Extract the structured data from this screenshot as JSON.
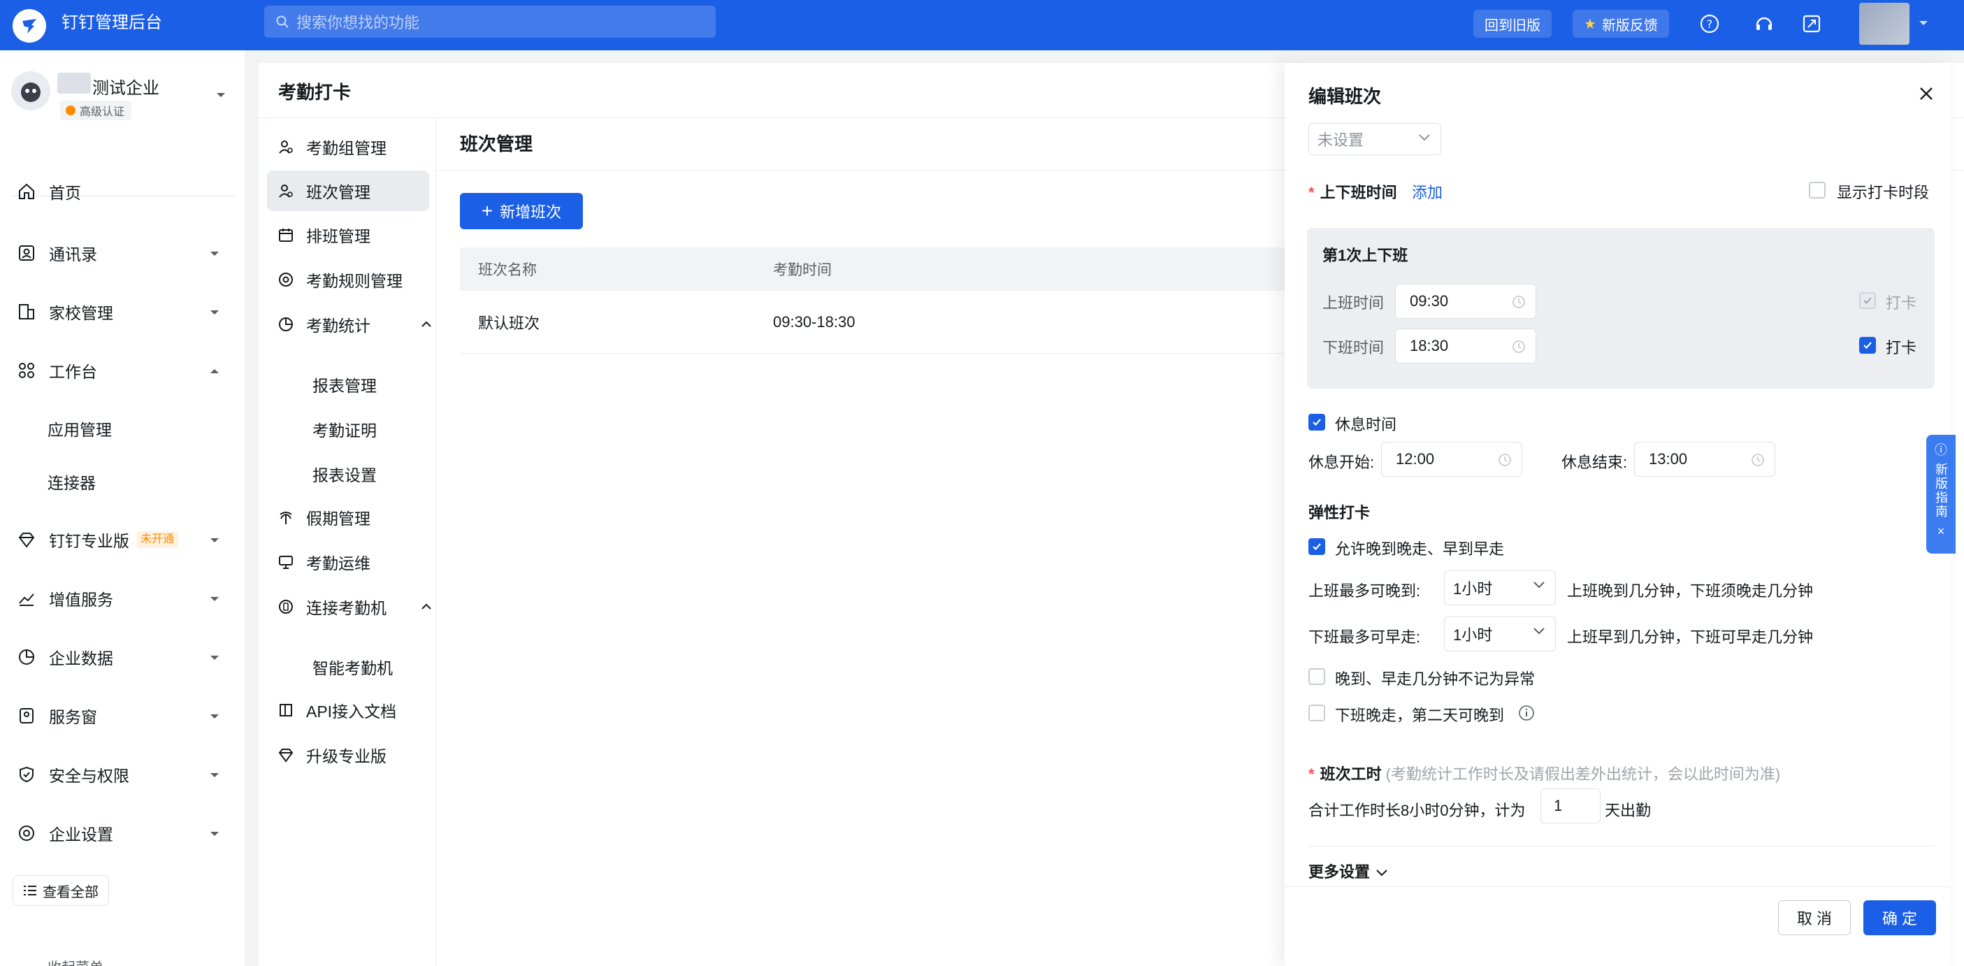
{
  "topbar": {
    "app_title": "钉钉管理后台",
    "search_placeholder": "搜索你想找的功能",
    "old_version": "回到旧版",
    "feedback": "新版反馈"
  },
  "sidebar": {
    "org_name": "测试企业",
    "org_badge": "高级认证",
    "items": [
      {
        "label": "首页"
      },
      {
        "label": "通讯录"
      },
      {
        "label": "家校管理"
      },
      {
        "label": "工作台"
      },
      {
        "label": "钉钉专业版",
        "tag": "未开通"
      },
      {
        "label": "增值服务"
      },
      {
        "label": "企业数据"
      },
      {
        "label": "服务窗"
      },
      {
        "label": "安全与权限"
      },
      {
        "label": "企业设置"
      }
    ],
    "workbench_subs": [
      "应用管理",
      "连接器"
    ],
    "view_all": "查看全部",
    "collapse": "收起菜单"
  },
  "main": {
    "page_title": "考勤打卡",
    "subnav": [
      {
        "label": "考勤组管理"
      },
      {
        "label": "班次管理"
      },
      {
        "label": "排班管理"
      },
      {
        "label": "考勤规则管理"
      },
      {
        "label": "考勤统计"
      },
      {
        "label": "假期管理"
      },
      {
        "label": "考勤运维"
      },
      {
        "label": "连接考勤机"
      },
      {
        "label": "API接入文档"
      },
      {
        "label": "升级专业版"
      }
    ],
    "stats_subs": [
      "报表管理",
      "考勤证明",
      "报表设置"
    ],
    "machine_subs": [
      "智能考勤机"
    ],
    "content_title": "班次管理",
    "add_button": "新增班次",
    "table": {
      "headers": [
        "班次名称",
        "考勤时间"
      ],
      "rows": [
        [
          "默认班次",
          "09:30-18:30"
        ]
      ]
    }
  },
  "drawer": {
    "title": "编辑班次",
    "top_select": "未设置",
    "work_time_label": "上下班时间",
    "add_link": "添加",
    "show_period": "显示打卡时段",
    "shift1_title": "第1次上下班",
    "on_label": "上班时间",
    "on_time": "09:30",
    "off_label": "下班时间",
    "off_time": "18:30",
    "punch": "打卡",
    "rest_label": "休息时间",
    "rest_start_label": "休息开始:",
    "rest_start": "12:00",
    "rest_end_label": "休息结束:",
    "rest_end": "13:00",
    "flex_title": "弹性打卡",
    "flex_allow": "允许晚到晚走、早到早走",
    "late_label": "上班最多可晚到:",
    "late_value": "1小时",
    "late_desc": "上班晚到几分钟，下班须晚走几分钟",
    "early_label": "下班最多可早走:",
    "early_value": "1小时",
    "early_desc": "上班早到几分钟，下班可早走几分钟",
    "no_abnormal": "晚到、早走几分钟不记为异常",
    "next_day_late": "下班晚走，第二天可晚到",
    "hours_title": "班次工时",
    "hours_hint": "(考勤统计工作时长及请假出差外出统计，会以此时间为准)",
    "hours_prefix": "合计工作时长8小时0分钟，计为",
    "hours_days": "1",
    "hours_suffix": "天出勤",
    "more_settings": "更多设置",
    "cancel": "取 消",
    "ok": "确 定"
  },
  "guide": {
    "label": "新版指南"
  },
  "colors": {
    "brand": "#1b5fe6",
    "accent_orange": "#ff8a00",
    "required": "#ff4d4f"
  }
}
